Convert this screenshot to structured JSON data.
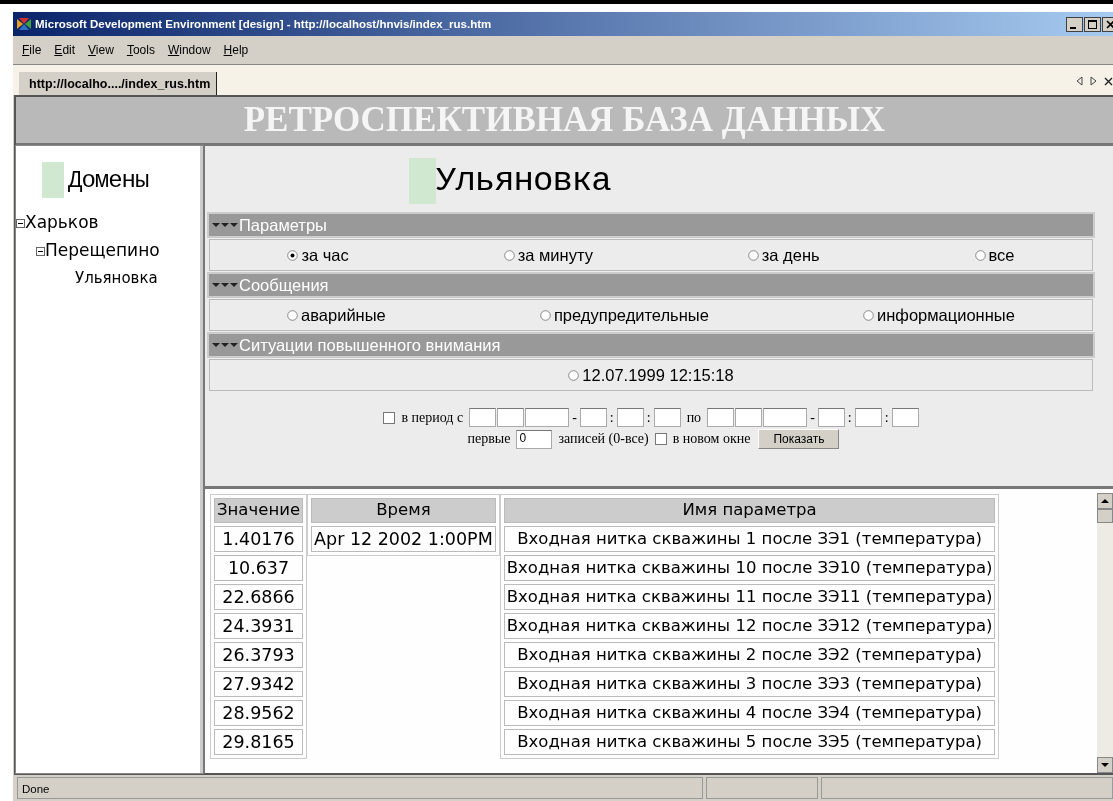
{
  "window": {
    "title": "Microsoft Development Environment [design] - http://localhost/hnvis/index_rus.htm"
  },
  "menu": [
    {
      "label": "File"
    },
    {
      "label": "Edit"
    },
    {
      "label": "View"
    },
    {
      "label": "Tools"
    },
    {
      "label": "Window"
    },
    {
      "label": "Help"
    }
  ],
  "document_tab": {
    "label": "http://localho..../index_rus.htm",
    "selected": true
  },
  "banner": "РЕТРОСПЕКТИВНАЯ БАЗА ДАННЫХ",
  "sidebar": {
    "title": "Домены",
    "tree": [
      {
        "label": "Харьков",
        "expanded": true,
        "children": [
          {
            "label": "Перещепино",
            "expanded": true,
            "children": [
              {
                "label": "Ульяновка"
              }
            ]
          }
        ]
      }
    ]
  },
  "domain_title": "Ульяновка",
  "sections": [
    {
      "title": "Параметры",
      "options": [
        {
          "label": "за час",
          "selected": true
        },
        {
          "label": "за минуту",
          "selected": false
        },
        {
          "label": "за день",
          "selected": false
        },
        {
          "label": "все",
          "selected": false
        }
      ]
    },
    {
      "title": "Сообщения",
      "options": [
        {
          "label": "аварийные",
          "selected": false
        },
        {
          "label": "предупредительные",
          "selected": false
        },
        {
          "label": "информационные",
          "selected": false
        }
      ]
    },
    {
      "title": "Ситуации повышенного внимания",
      "options": [
        {
          "label": "12.07.1999 12:15:18",
          "selected": false
        }
      ]
    }
  ],
  "filter": {
    "period_checked": false,
    "period_label": "в период с",
    "from_separators": [
      "-",
      ":",
      ":"
    ],
    "to_label": "по",
    "to_separators": [
      "-",
      ":",
      ":"
    ],
    "first_label": "первые",
    "first_value": "0",
    "records_label": "записей (0-все)",
    "new_window_checked": false,
    "new_window_label": "в новом окне",
    "button": "Показать"
  },
  "table": {
    "columns": [
      "Значение",
      "Время",
      "Имя параметра"
    ],
    "values": [
      "1.40176",
      "10.637",
      "22.6866",
      "24.3931",
      "26.3793",
      "27.9342",
      "28.9562",
      "29.8165"
    ],
    "time": "Apr 12 2002 1:00PM",
    "names": [
      "Входная нитка скважины 1 после ЗЭ1 (температура)",
      "Входная нитка скважины 10 после ЗЭ10 (температура)",
      "Входная нитка скважины 11 после ЗЭ11 (температура)",
      "Входная нитка скважины 12 после ЗЭ12 (температура)",
      "Входная нитка скважины 2 после ЗЭ2 (температура)",
      "Входная нитка скважины 3 после ЗЭ3 (температура)",
      "Входная нитка скважины 4 после ЗЭ4 (температура)",
      "Входная нитка скважины 5 после ЗЭ5 (температура)"
    ]
  },
  "status_bar": {
    "text": "Done"
  }
}
